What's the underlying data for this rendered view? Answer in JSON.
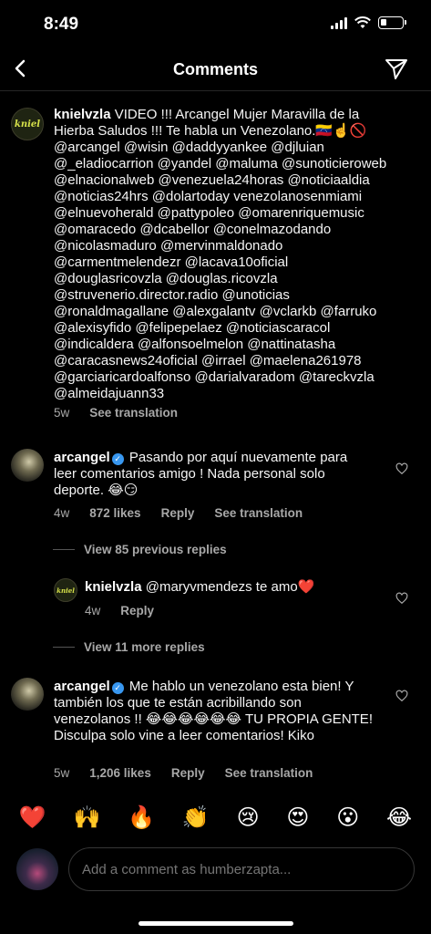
{
  "status_bar": {
    "time": "8:49"
  },
  "header": {
    "title": "Comments"
  },
  "caption": {
    "avatar_text": "kniel",
    "username": "knielvzla",
    "text": "VIDEO !!! Arcangel Mujer Maravilla de la Hierba Saludos !!! Te habla un Venezolano.🇻🇪☝️🚫 @arcangel @wisin @daddyyankee @djluian @_eladiocarrion @yandel @maluma @sunoticieroweb @elnacionalweb @venezuela24horas @noticiaaldia @noticias24hrs @dolartoday venezolanosenmiami @elnuevoherald @pattypoleo @omarenriquemusic @omaracedo @dcabellor @conelmazodando @nicolasmaduro @mervinmaldonado @carmentmelendezr @lacava10oficial @douglasricovzla @douglas.ricovzla @struvenerio.director.radio @unoticias @ronaldmagallane @alexgalantv @vclarkb @farruko @alexisyfido @felipepelaez @noticiascaracol @indicaldera @alfonsoelmelon @nattinatasha @caracasnews24oficial @irrael @maelena261978 @garciaricardoalfonso @darialvaradom @tareckvzla @almeidajuann33",
    "time": "5w",
    "see_translation": "See translation"
  },
  "comment1": {
    "username": "arcangel",
    "text": "Pasando por aquí nuevamente para leer comentarios amigo ! Nada personal solo deporte. 😂😏",
    "time": "4w",
    "likes": "872 likes",
    "reply": "Reply",
    "see_translation": "See translation"
  },
  "view_previous": "View 85 previous replies",
  "reply1": {
    "avatar_text": "kniel",
    "username": "knielvzla",
    "text": "@maryvmendezs te amo❤️",
    "time": "4w",
    "reply": "Reply"
  },
  "view_more": "View 11 more replies",
  "comment2": {
    "username": "arcangel",
    "text": "Me hablo un venezolano esta bien! Y también los que te están acribillando son venezolanos !! 😂😂😂😂😂😂 TU PROPIA GENTE! Disculpa solo vine a leer comentarios! Kiko",
    "time": "5w",
    "likes": "1,206 likes",
    "reply": "Reply",
    "see_translation": "See translation"
  },
  "emoji_bar": [
    "❤️",
    "🙌",
    "🔥",
    "👏",
    "😢",
    "😍",
    "😮",
    "😂"
  ],
  "composer": {
    "placeholder": "Add a comment as humberzapta..."
  },
  "colors": {
    "background": "#000000",
    "verified": "#3897f0",
    "secondary_text": "#a8a8a8"
  }
}
